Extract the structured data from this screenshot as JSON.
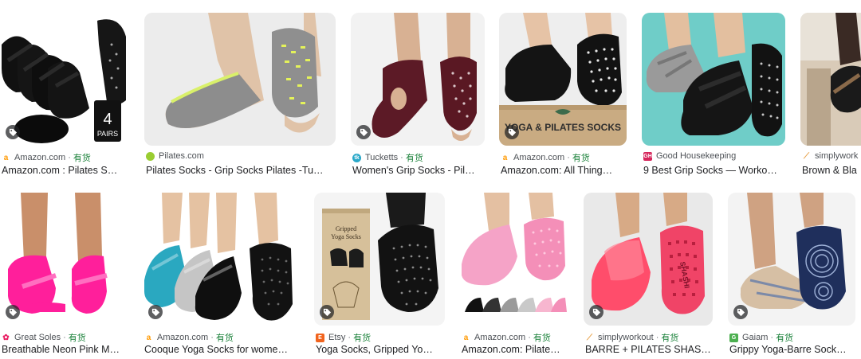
{
  "colors": {
    "in_stock": "#188038",
    "source_text": "#4d5156",
    "title_text": "#202124"
  },
  "rows": [
    {
      "cards": [
        {
          "source": "Amazon.com",
          "stock": "有货",
          "title": "Amazon.com : Pilates S…",
          "favicon": "amazon-icon",
          "thumb_label": "4\nPAIRS"
        },
        {
          "source": "Pilates.com",
          "stock": "",
          "title": "Pilates Socks - Grip Socks Pilates -Tu…",
          "favicon": "pilates-icon"
        },
        {
          "source": "Tucketts",
          "stock": "有货",
          "title": "Women's Grip Socks - Pil…",
          "favicon": "tucketts-icon"
        },
        {
          "source": "Amazon.com",
          "stock": "有货",
          "title": "Amazon.com: All Thing…",
          "favicon": "amazon-icon",
          "thumb_label": "YOGA & PILATES SOCKS"
        },
        {
          "source": "Good Housekeeping",
          "stock": "",
          "title": "9 Best Grip Socks — Worko…",
          "favicon": "good-housekeeping-icon"
        },
        {
          "source": "simplywork",
          "stock": "",
          "title": "Brown & Bla",
          "favicon": "simplyworkout-icon"
        }
      ]
    },
    {
      "cards": [
        {
          "source": "Great Soles",
          "stock": "有货",
          "title": "Breathable Neon Pink M…",
          "favicon": "great-soles-icon"
        },
        {
          "source": "Amazon.com",
          "stock": "有货",
          "title": "Cooque Yoga Socks for wome…",
          "favicon": "amazon-icon"
        },
        {
          "source": "Etsy",
          "stock": "有货",
          "title": "Yoga Socks, Gripped Yo…",
          "favicon": "etsy-icon",
          "thumb_label": "Gripped\nYoga Socks"
        },
        {
          "source": "Amazon.com",
          "stock": "有货",
          "title": "Amazon.com: Pilate…",
          "favicon": "amazon-icon"
        },
        {
          "source": "simplyworkout",
          "stock": "有货",
          "title": "BARRE + PILATES SHAS…",
          "favicon": "simplyworkout-icon",
          "thumb_label": "SHASHI"
        },
        {
          "source": "Gaiam",
          "stock": "有货",
          "title": "Grippy Yoga-Barre Sock…",
          "favicon": "gaiam-icon"
        }
      ]
    }
  ]
}
